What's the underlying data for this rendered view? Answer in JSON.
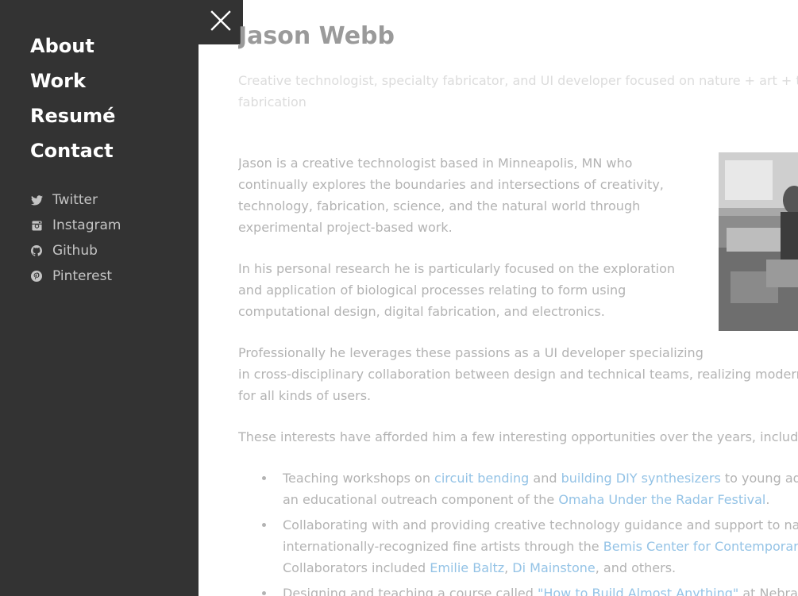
{
  "nav": {
    "items": [
      {
        "label": "About"
      },
      {
        "label": "Work"
      },
      {
        "label": "Resumé"
      },
      {
        "label": "Contact"
      }
    ]
  },
  "social": {
    "items": [
      {
        "label": "Twitter",
        "icon": "twitter-icon"
      },
      {
        "label": "Instagram",
        "icon": "instagram-icon"
      },
      {
        "label": "Github",
        "icon": "github-icon"
      },
      {
        "label": "Pinterest",
        "icon": "pinterest-icon"
      }
    ]
  },
  "close": {
    "icon": "close-icon"
  },
  "main": {
    "title": "Jason Webb",
    "subtitle_line1": "Creative technologist, specialty fabricator, and UI developer focused on nature + art + tec",
    "subtitle_line2": "fabrication",
    "p1": "Jason is a creative technologist based in Minneapolis, MN who continually explores the boundaries and intersections of creativity, technology, fabrication, science, and the natural world through experimental project-based work.",
    "p2": "In his personal research he is particularly focused on the exploration and application of biological processes relating to form using computational design, digital fabrication, and electronics.",
    "p3_line1": "Professionally he leverages these passions as a UI developer specializing",
    "p3_line2": "in cross-disciplinary collaboration between design and technical teams, realizing modern",
    "p3_line3": "for all kinds of users.",
    "p4": "These interests have afforded him a few interesting opportunities over the years, includin",
    "list": {
      "item1": {
        "t1": "Teaching workshops on ",
        "l1": "circuit bending",
        "t2": " and ",
        "l2": "building DIY synthesizers",
        "t3": " to young ad",
        "t4": "an educational outreach component of the ",
        "l3": "Omaha Under the Radar Festival",
        "t5": "."
      },
      "item2": {
        "t1": "Collaborating with and providing creative technology guidance and support to na",
        "t2": "internationally-recognized fine artists through the ",
        "l1": "Bemis Center for Contemporary",
        "t3": "Collaborators included ",
        "l2": "Emilie Baltz",
        "t4": ", ",
        "l3": "Di Mainstone",
        "t5": ", and others."
      },
      "item3": {
        "t1": "Designing and teaching a course called ",
        "l1": "\"How to Build Almost Anything\"",
        "t2": " at Nebras"
      }
    }
  },
  "colors": {
    "sidebar_bg": "#333333",
    "nav_text": "#ffffff",
    "social_text": "#c4c4c4",
    "body_text_dimmed": "#b3b3b3",
    "link_dimmed": "#94c3e6"
  }
}
